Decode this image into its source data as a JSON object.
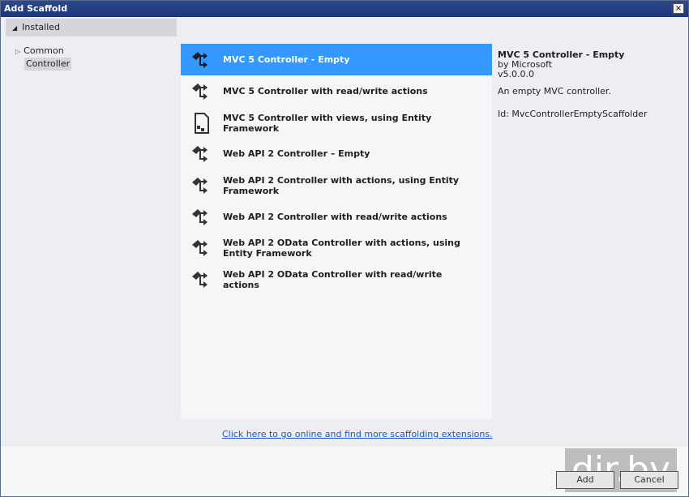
{
  "window": {
    "title": "Add Scaffold",
    "close_icon": "×"
  },
  "sidebar": {
    "header": "Installed",
    "items": [
      {
        "label": "Common"
      },
      {
        "label": "Controller"
      }
    ]
  },
  "list": [
    {
      "label": "MVC 5 Controller - Empty",
      "icon": "controller-icon"
    },
    {
      "label": "MVC 5 Controller with read/write actions",
      "icon": "controller-icon"
    },
    {
      "label": "MVC 5 Controller with views, using Entity Framework",
      "icon": "document-controller-icon"
    },
    {
      "label": "Web API 2 Controller – Empty",
      "icon": "controller-icon"
    },
    {
      "label": "Web API 2 Controller with actions, using Entity Framework",
      "icon": "controller-icon"
    },
    {
      "label": "Web API 2 Controller with read/write actions",
      "icon": "controller-icon"
    },
    {
      "label": "Web API 2 OData Controller with actions, using Entity Framework",
      "icon": "controller-icon"
    },
    {
      "label": "Web API 2 OData Controller with read/write actions",
      "icon": "controller-icon"
    }
  ],
  "details": {
    "title": "MVC 5 Controller - Empty",
    "author": "by Microsoft",
    "version": "v5.0.0.0",
    "description": "An empty MVC controller.",
    "id": "Id: MvcControllerEmptyScaffolder"
  },
  "online_link": "Click here to go online and find more scaffolding extensions.",
  "buttons": {
    "add": "Add",
    "cancel": "Cancel"
  },
  "watermark": "dir.by",
  "colors": {
    "selection": "#3399ff",
    "titlebar": "#1c3676"
  }
}
